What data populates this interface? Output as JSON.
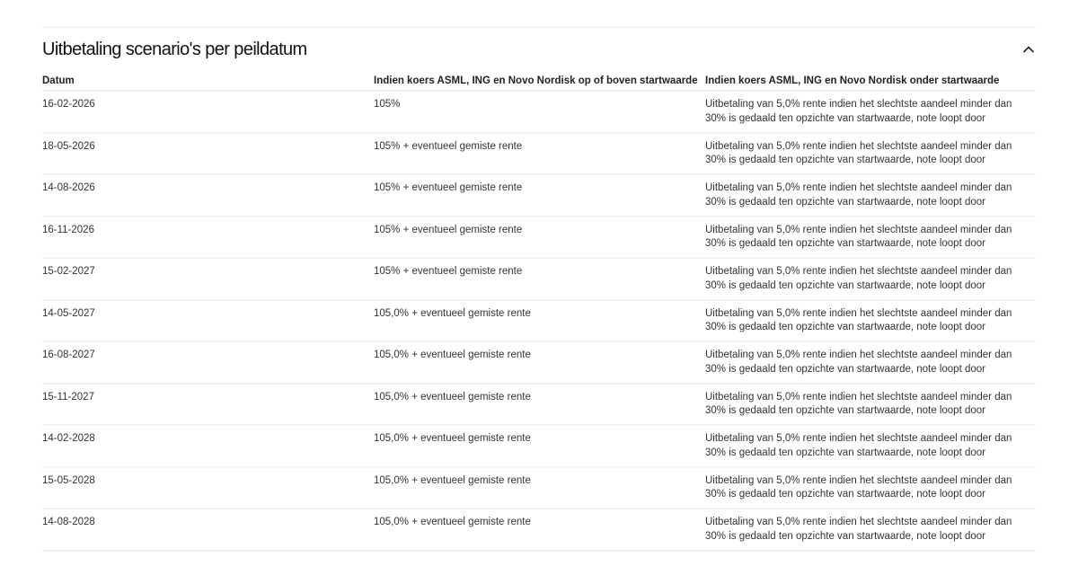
{
  "section": {
    "title": "Uitbetaling scenario's per peildatum",
    "chevron_icon": "chevron-up-icon"
  },
  "table": {
    "headers": [
      "Datum",
      "Indien koers ASML, ING en Novo Nordisk op of boven startwaarde",
      "Indien koers ASML, ING en Novo Nordisk onder startwaarde"
    ],
    "rows": [
      {
        "date": "16-02-2026",
        "above": "105%",
        "below": "Uitbetaling van 5,0% rente indien het slechtste aandeel minder dan 30% is gedaald ten opzichte van startwaarde, note loopt door"
      },
      {
        "date": "18-05-2026",
        "above": "105% + eventueel gemiste rente",
        "below": "Uitbetaling van 5,0% rente indien het slechtste aandeel minder dan 30% is gedaald ten opzichte van startwaarde, note loopt door"
      },
      {
        "date": "14-08-2026",
        "above": "105% + eventueel gemiste rente",
        "below": "Uitbetaling van 5,0% rente indien het slechtste aandeel minder dan 30% is gedaald ten opzichte van startwaarde, note loopt door"
      },
      {
        "date": "16-11-2026",
        "above": "105% + eventueel gemiste rente",
        "below": "Uitbetaling van 5,0% rente indien het slechtste aandeel minder dan 30% is gedaald ten opzichte van startwaarde, note loopt door"
      },
      {
        "date": "15-02-2027",
        "above": "105% + eventueel gemiste rente",
        "below": "Uitbetaling van 5,0% rente indien het slechtste aandeel minder dan 30% is gedaald ten opzichte van startwaarde, note loopt door"
      },
      {
        "date": "14-05-2027",
        "above": "105,0% + eventueel gemiste rente",
        "below": "Uitbetaling van 5,0% rente indien het slechtste aandeel minder dan 30% is gedaald ten opzichte van startwaarde, note loopt door"
      },
      {
        "date": "16-08-2027",
        "above": "105,0% + eventueel gemiste rente",
        "below": "Uitbetaling van 5,0% rente indien het slechtste aandeel minder dan 30% is gedaald ten opzichte van startwaarde, note loopt door"
      },
      {
        "date": "15-11-2027",
        "above": "105,0% + eventueel gemiste rente",
        "below": "Uitbetaling van 5,0% rente indien het slechtste aandeel minder dan 30% is gedaald ten opzichte van startwaarde, note loopt door"
      },
      {
        "date": "14-02-2028",
        "above": "105,0% + eventueel gemiste rente",
        "below": "Uitbetaling van 5,0% rente indien het slechtste aandeel minder dan 30% is gedaald ten opzichte van startwaarde, note loopt door"
      },
      {
        "date": "15-05-2028",
        "above": "105,0% + eventueel gemiste rente",
        "below": "Uitbetaling van 5,0% rente indien het slechtste aandeel minder dan 30% is gedaald ten opzichte van startwaarde, note loopt door"
      },
      {
        "date": "14-08-2028",
        "above": "105,0% + eventueel gemiste rente",
        "below": "Uitbetaling van 5,0% rente indien het slechtste aandeel minder dan 30% is gedaald ten opzichte van startwaarde, note loopt door"
      }
    ]
  }
}
